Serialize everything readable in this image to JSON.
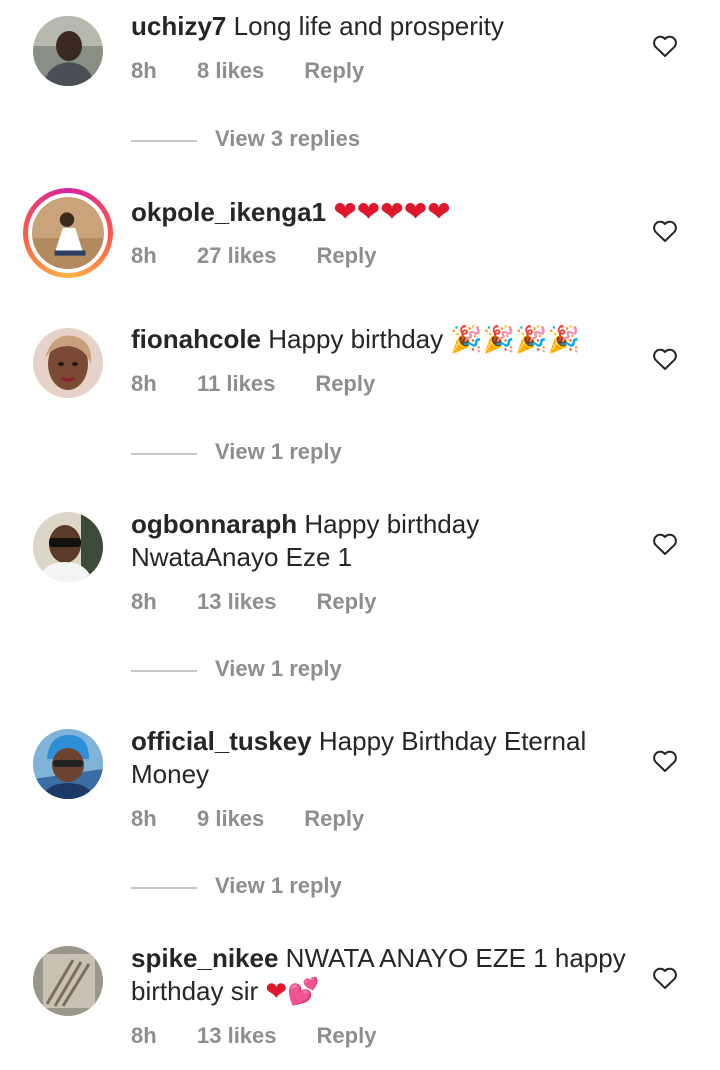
{
  "colors": {
    "meta": "#8e8e8e",
    "text": "#262626",
    "heart_emoji": "#e0162b"
  },
  "comments": [
    {
      "username": "uchizy7",
      "text": "Long life and prosperity",
      "time": "8h",
      "likes": "8 likes",
      "reply": "Reply",
      "view_replies": "View 3 replies",
      "avatar": "avatar-uchizy7"
    },
    {
      "username": "okpole_ikenga1",
      "text": "",
      "emoji": "❤❤❤❤❤",
      "time": "8h",
      "likes": "27 likes",
      "reply": "Reply",
      "avatar": "avatar-okpole-ikenga1"
    },
    {
      "username": "fionahcole",
      "text": "Happy birthday",
      "emoji": "🎉🎉🎉🎉",
      "time": "8h",
      "likes": "11 likes",
      "reply": "Reply",
      "view_replies": "View 1 reply",
      "avatar": "avatar-fionahcole"
    },
    {
      "username": "ogbonnaraph",
      "text": "Happy birthday NwataAnayo Eze 1",
      "time": "8h",
      "likes": "13 likes",
      "reply": "Reply",
      "view_replies": "View 1 reply",
      "avatar": "avatar-ogbonnaraph"
    },
    {
      "username": "official_tuskey",
      "text": "Happy Birthday Eternal Money",
      "time": "8h",
      "likes": "9 likes",
      "reply": "Reply",
      "view_replies": "View 1 reply",
      "avatar": "avatar-official-tuskey"
    },
    {
      "username": "spike_nikee",
      "text": "NWATA ANAYO EZE 1 happy birthday sir",
      "emoji": "❤💕",
      "time": "8h",
      "likes": "13 likes",
      "reply": "Reply",
      "avatar": "avatar-spike-nikee"
    }
  ]
}
